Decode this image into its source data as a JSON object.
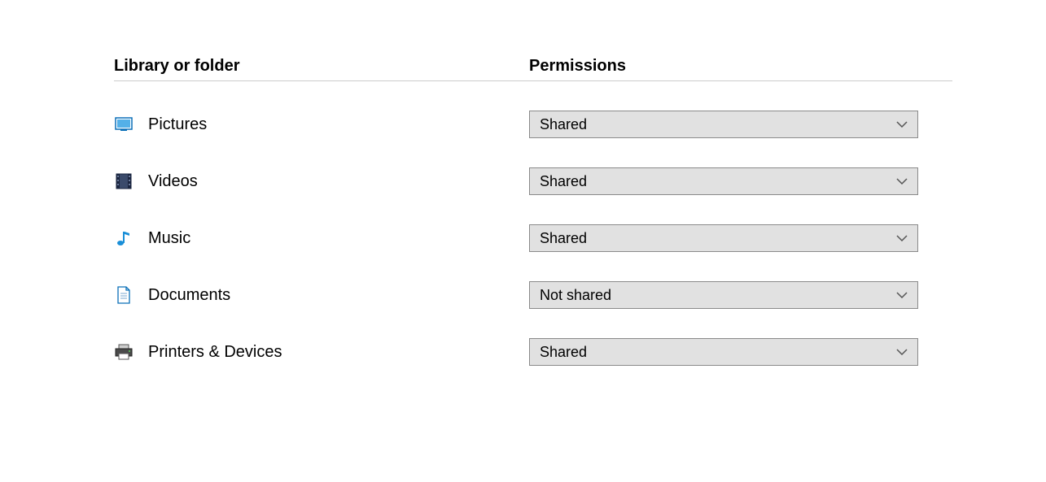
{
  "headers": {
    "library": "Library or folder",
    "permissions": "Permissions"
  },
  "rows": [
    {
      "icon": "pictures-icon",
      "label": "Pictures",
      "permission": "Shared"
    },
    {
      "icon": "videos-icon",
      "label": "Videos",
      "permission": "Shared"
    },
    {
      "icon": "music-icon",
      "label": "Music",
      "permission": "Shared"
    },
    {
      "icon": "documents-icon",
      "label": "Documents",
      "permission": "Not shared"
    },
    {
      "icon": "printers-icon",
      "label": "Printers & Devices",
      "permission": "Shared"
    }
  ]
}
